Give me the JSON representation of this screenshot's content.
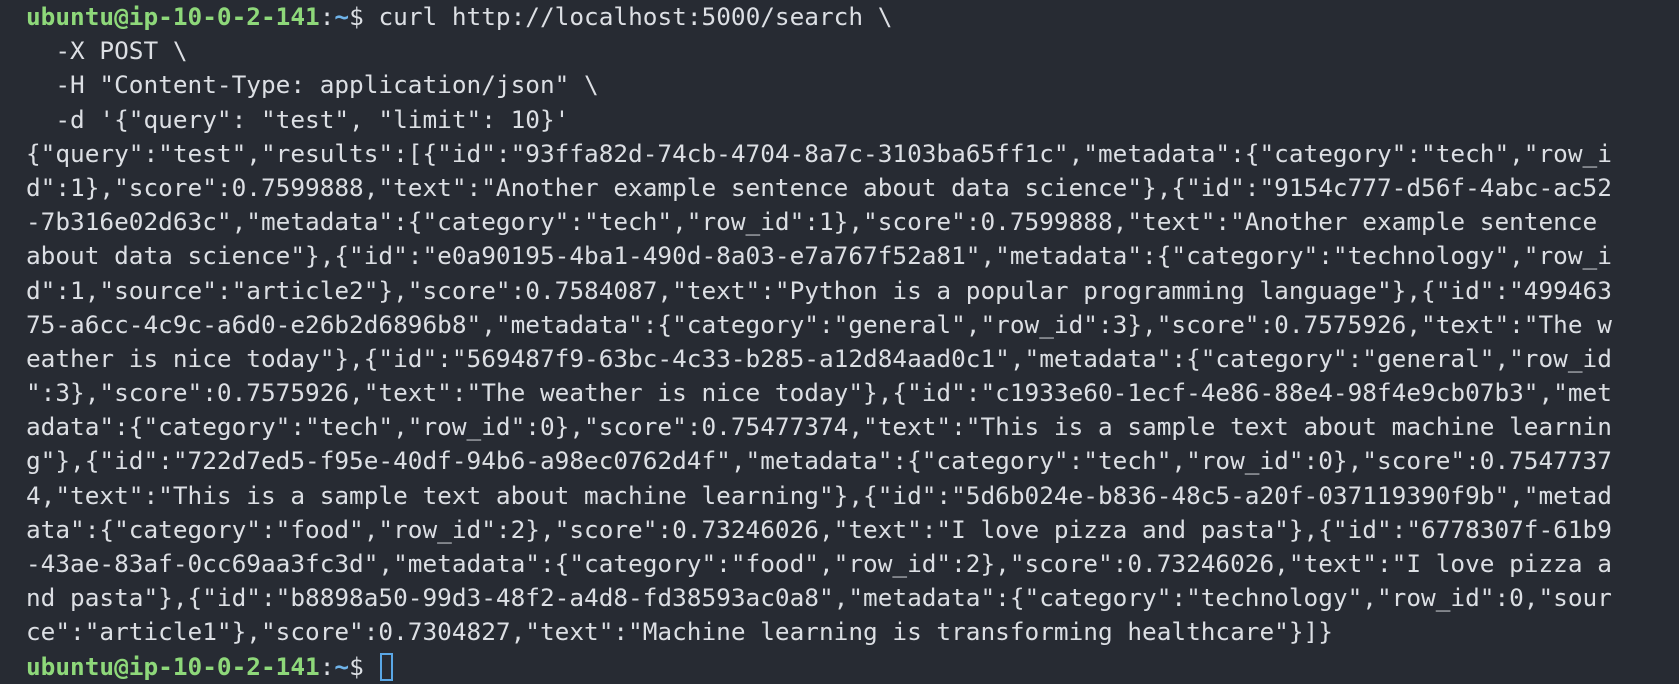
{
  "prompt": {
    "user_host": "ubuntu@ip-10-0-2-141",
    "separator": ":",
    "path": "~",
    "dollar": "$ "
  },
  "command": {
    "line1": "curl http://localhost:5000/search \\",
    "line2": "  -X POST \\",
    "line3": "  -H \"Content-Type: application/json\" \\",
    "line4": "  -d '{\"query\": \"test\", \"limit\": 10}'"
  },
  "output": [
    "{\"query\":\"test\",\"results\":[{\"id\":\"93ffa82d-74cb-4704-8a7c-3103ba65ff1c\",\"metadata\":{\"category\":\"tech\",\"row_i",
    "d\":1},\"score\":0.7599888,\"text\":\"Another example sentence about data science\"},{\"id\":\"9154c777-d56f-4abc-ac52",
    "-7b316e02d63c\",\"metadata\":{\"category\":\"tech\",\"row_id\":1},\"score\":0.7599888,\"text\":\"Another example sentence ",
    "about data science\"},{\"id\":\"e0a90195-4ba1-490d-8a03-e7a767f52a81\",\"metadata\":{\"category\":\"technology\",\"row_i",
    "d\":1,\"source\":\"article2\"},\"score\":0.7584087,\"text\":\"Python is a popular programming language\"},{\"id\":\"499463",
    "75-a6cc-4c9c-a6d0-e26b2d6896b8\",\"metadata\":{\"category\":\"general\",\"row_id\":3},\"score\":0.7575926,\"text\":\"The w",
    "eather is nice today\"},{\"id\":\"569487f9-63bc-4c33-b285-a12d84aad0c1\",\"metadata\":{\"category\":\"general\",\"row_id",
    "\":3},\"score\":0.7575926,\"text\":\"The weather is nice today\"},{\"id\":\"c1933e60-1ecf-4e86-88e4-98f4e9cb07b3\",\"met",
    "adata\":{\"category\":\"tech\",\"row_id\":0},\"score\":0.75477374,\"text\":\"This is a sample text about machine learnin",
    "g\"},{\"id\":\"722d7ed5-f95e-40df-94b6-a98ec0762d4f\",\"metadata\":{\"category\":\"tech\",\"row_id\":0},\"score\":0.7547737",
    "4,\"text\":\"This is a sample text about machine learning\"},{\"id\":\"5d6b024e-b836-48c5-a20f-037119390f9b\",\"metad",
    "ata\":{\"category\":\"food\",\"row_id\":2},\"score\":0.73246026,\"text\":\"I love pizza and pasta\"},{\"id\":\"6778307f-61b9",
    "-43ae-83af-0cc69aa3fc3d\",\"metadata\":{\"category\":\"food\",\"row_id\":2},\"score\":0.73246026,\"text\":\"I love pizza a",
    "nd pasta\"},{\"id\":\"b8898a50-99d3-48f2-a4d8-fd38593ac0a8\",\"metadata\":{\"category\":\"technology\",\"row_id\":0,\"sour",
    "ce\":\"article1\"},\"score\":0.7304827,\"text\":\"Machine learning is transforming healthcare\"}]}"
  ],
  "colors": {
    "background": "#272b33",
    "foreground": "#dcdfe4",
    "user_host": "#8ed87a",
    "path": "#6fb3e8",
    "cursor": "#5aa7e6"
  }
}
